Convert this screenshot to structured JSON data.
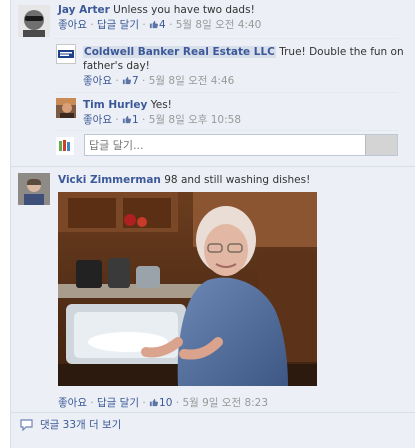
{
  "comments": [
    {
      "author": "Jay Arter",
      "text": "Unless you have two dads!",
      "like_label": "좋아요",
      "reply_label": "답글 달기",
      "likes": "4",
      "time": "5월 8일 오전 4:40"
    },
    {
      "author": "Vicki Zimmerman",
      "text": "98 and still washing dishes!",
      "like_label": "좋아요",
      "reply_label": "답글 달기",
      "likes": "10",
      "time": "5월 9일 오전 8:23"
    }
  ],
  "replies": [
    {
      "author": "Coldwell Banker Real Estate LLC",
      "text_line1": "True! Double the fun on",
      "text_line2": "father's day!",
      "like_label": "좋아요",
      "likes": "7",
      "time": "5월 8일 오전 4:46"
    },
    {
      "author": "Tim Hurley",
      "text": "Yes!",
      "like_label": "좋아요",
      "likes": "1",
      "time": "5월 8일 오후 10:58"
    }
  ],
  "separator": "·",
  "reply_input": {
    "placeholder": "답글 달기..."
  },
  "more_comments": "댓글 33개 더 보기",
  "colors": {
    "link": "#3b5998",
    "background": "#eceff5",
    "muted": "#999999",
    "highlight": "#d8dfea"
  },
  "icons": {
    "like": "thumbs-up-icon",
    "comments": "speech-bubble-icon"
  }
}
